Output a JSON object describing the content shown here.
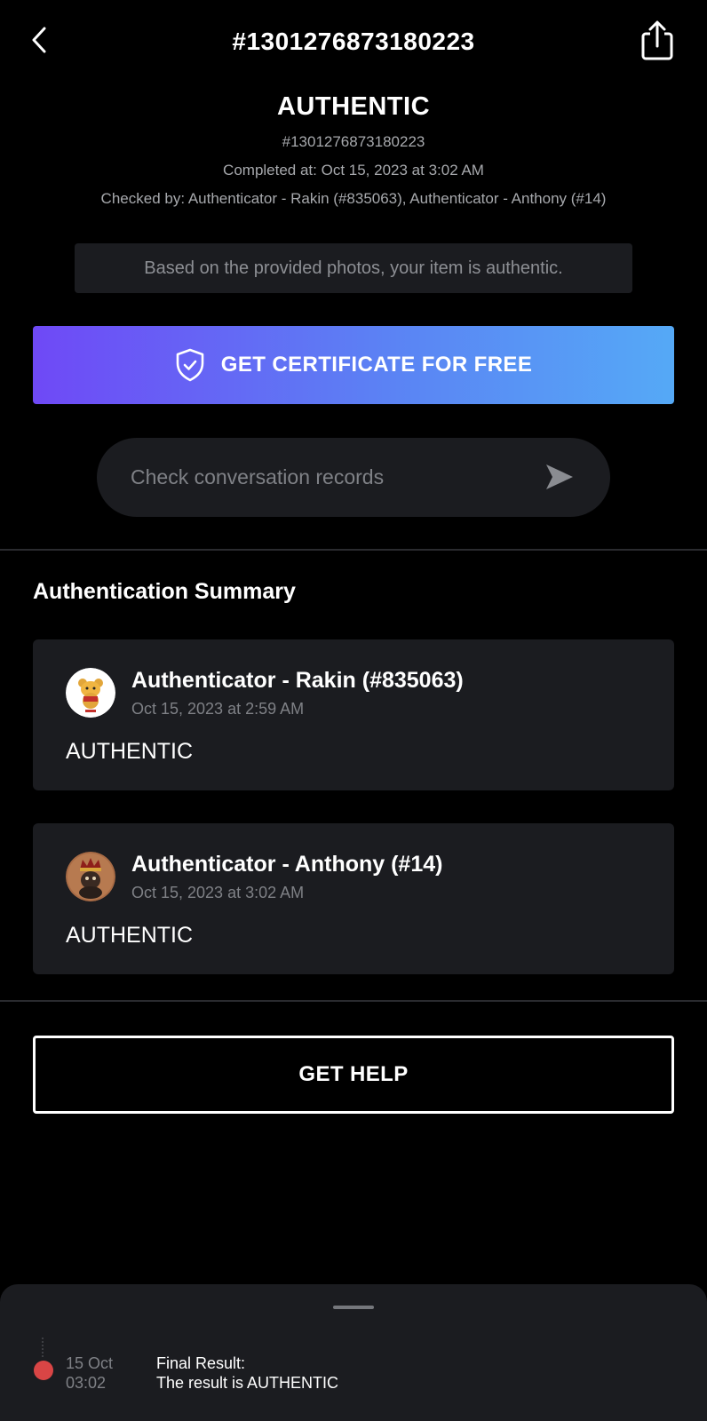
{
  "header": {
    "title": "#1301276873180223",
    "back_icon": "chevron-left-icon",
    "share_icon": "share-icon"
  },
  "status": {
    "title": "AUTHENTIC",
    "order_id": "#1301276873180223",
    "completed_at": "Completed at: Oct 15, 2023 at 3:02 AM",
    "checked_by": "Checked by: Authenticator - Rakin (#835063), Authenticator - Anthony (#14)",
    "note": "Based on the provided photos, your item is authentic."
  },
  "actions": {
    "certificate_label": "GET CERTIFICATE FOR FREE",
    "certificate_icon": "shield-check-icon",
    "conversation_label": "Check conversation records",
    "conversation_icon": "send-icon",
    "help_label": "GET HELP"
  },
  "summary": {
    "title": "Authentication Summary",
    "entries": [
      {
        "name": "Authenticator - Rakin (#835063)",
        "time": "Oct 15, 2023 at 2:59 AM",
        "result": "AUTHENTIC",
        "avatar": "bear-cartoon-avatar"
      },
      {
        "name": "Authenticator - Anthony (#14)",
        "time": "Oct 15, 2023 at 3:02 AM",
        "result": "AUTHENTIC",
        "avatar": "crowned-figure-avatar"
      }
    ]
  },
  "timeline": {
    "date": "15 Oct",
    "time": "03:02",
    "label": "Final Result:",
    "text": "The result is AUTHENTIC",
    "dot_color": "#d94545"
  },
  "colors": {
    "background": "#000000",
    "card": "#1b1c20",
    "gradient_start": "#6f49f6",
    "gradient_end": "#55a9f6",
    "muted_text": "#a7a9ad"
  }
}
